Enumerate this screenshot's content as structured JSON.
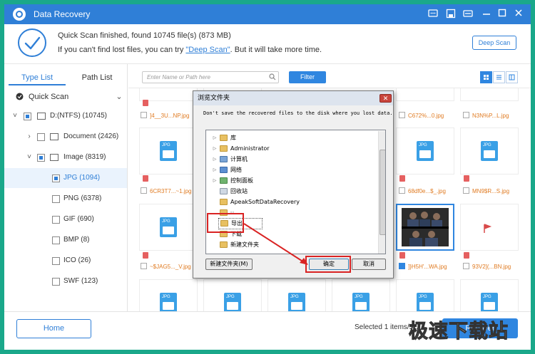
{
  "app": {
    "title": "Data Recovery",
    "accent": "#2f7fd7",
    "icons": [
      "chat-icon",
      "save-icon",
      "key-icon",
      "minimize-icon",
      "maximize-icon",
      "close-icon"
    ]
  },
  "scan": {
    "status_line": "Quick Scan finished, found 10745 file(s) (873 MB)",
    "hint_prefix": "If you can't find lost files, you can try ",
    "hint_link": "\"Deep Scan\"",
    "hint_suffix": ". But it will take more time.",
    "deep_scan_label": "Deep Scan"
  },
  "sidebar": {
    "tabs": [
      "Type List",
      "Path List"
    ],
    "quick_scan_label": "Quick Scan",
    "tree": [
      {
        "label": "D:(NTFS) (10745)"
      },
      {
        "label": "Document (2426)"
      },
      {
        "label": "Image (8319)"
      },
      {
        "label": "JPG (1094)"
      },
      {
        "label": "PNG (6378)"
      },
      {
        "label": "GIF (690)"
      },
      {
        "label": "BMP (8)"
      },
      {
        "label": "ICO (26)"
      },
      {
        "label": "SWF (123)"
      }
    ]
  },
  "toolbar": {
    "search_placeholder": "Enter Name or Path here",
    "filter_label": "Filter"
  },
  "files": [
    {
      "name": "]4__3U...NP.jpg",
      "selected": false
    },
    {
      "name": "C672%...0.jpg",
      "selected": false
    },
    {
      "name": "N3N%P...L.jpg",
      "selected": false
    },
    {
      "name": "6CR3T7...~1.jpg",
      "selected": false
    },
    {
      "name": "68df0e...$_.jpg",
      "selected": false
    },
    {
      "name": "MN9$R...S.jpg",
      "selected": false
    },
    {
      "name": "~$JAG5..._V.jpg",
      "selected": false
    },
    {
      "name": "]}H5H'...WA.jpg",
      "selected": true
    },
    {
      "name": "93V2](...BN.jpg",
      "selected": false
    }
  ],
  "footer": {
    "home_label": "Home",
    "selected_text": "Selected 1 items/5…",
    "recover_label": "Recover"
  },
  "dialog": {
    "title": "浏览文件夹",
    "message": "Don't save the recovered files to the disk where you lost data.",
    "folders": [
      "库",
      "Administrator",
      "计算机",
      "网络",
      "控制面板",
      "回收站",
      "ApeakSoftDataRecovery",
      "u...",
      "导出",
      "下载",
      "新建文件夹"
    ],
    "new_folder_label": "新建文件夹(M)",
    "ok_label": "确定",
    "cancel_label": "取消"
  },
  "watermark": "极速下载站"
}
